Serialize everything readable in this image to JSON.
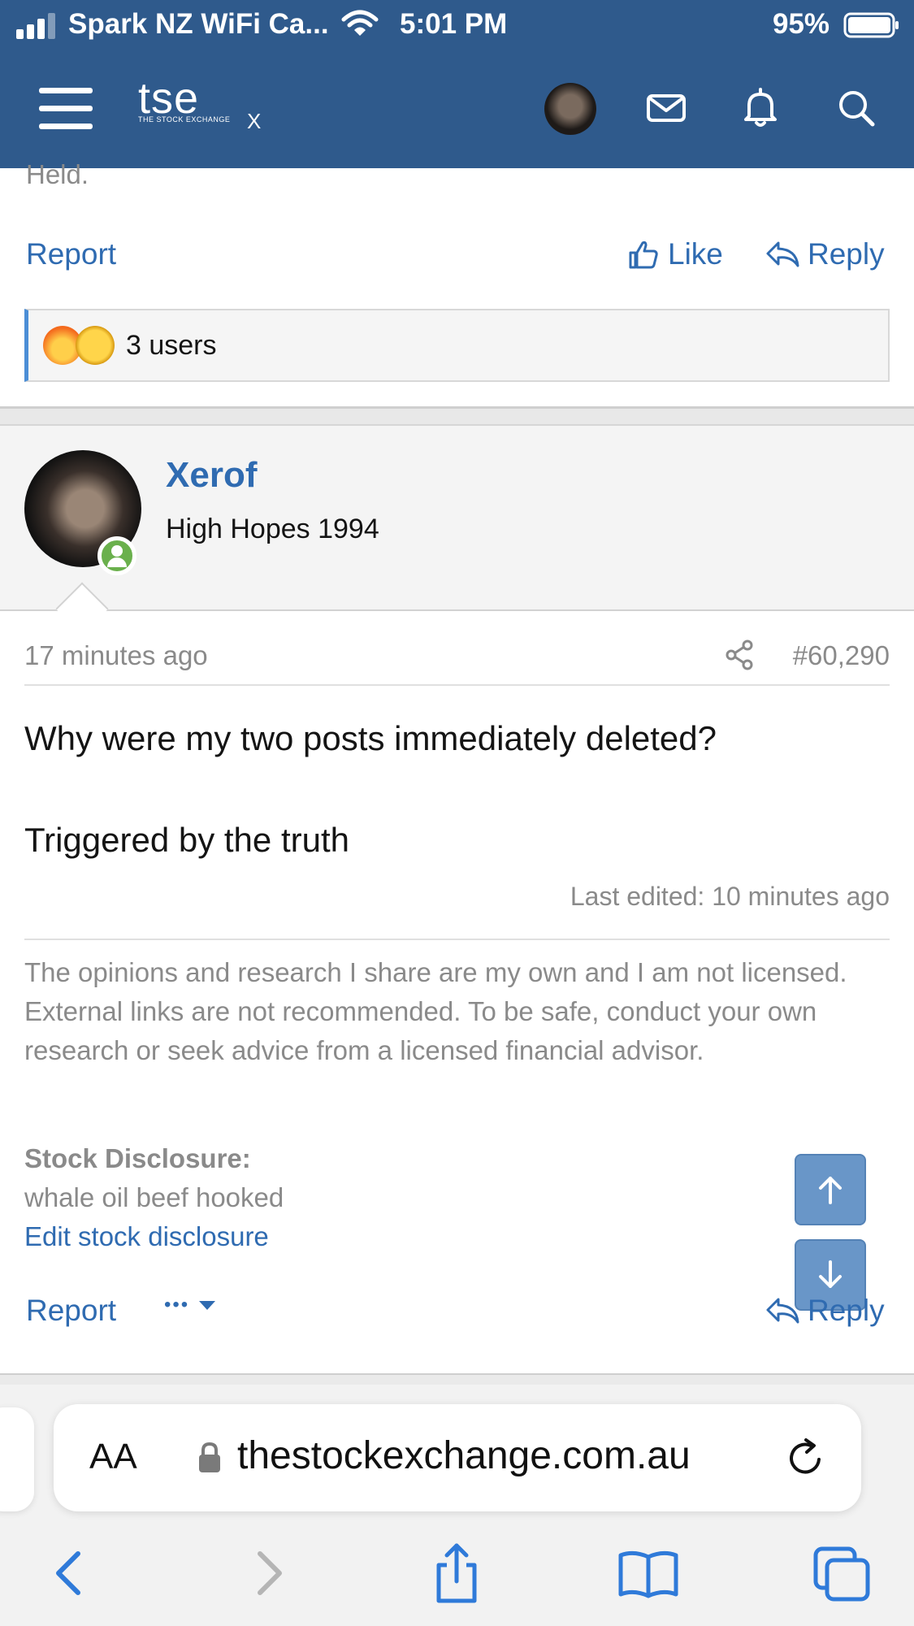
{
  "status_bar": {
    "carrier": "Spark NZ WiFi Ca...",
    "time": "5:01 PM",
    "battery": "95%"
  },
  "header": {
    "logo_text": "tse",
    "logo_subtitle": "THE STOCK EXCHANGE",
    "logo_mark": "X",
    "brand_color": "#2f5a8c",
    "icons": [
      "menu-icon",
      "avatar",
      "mail-icon",
      "bell-icon",
      "search-icon"
    ]
  },
  "previous_post": {
    "clipped_text": "Held.",
    "report": "Report",
    "like": "Like",
    "reply": "Reply",
    "reactions": {
      "emojis": [
        "fire",
        "rolling-laughing"
      ],
      "label": "3 users"
    }
  },
  "post": {
    "username": "Xerof",
    "user_title": "High Hopes 1994",
    "online": true,
    "time": "17 minutes ago",
    "post_number": "#60,290",
    "body": [
      "Why were my two posts immediately deleted?",
      "Triggered by the truth"
    ],
    "last_edited": "Last edited: 10 minutes ago",
    "signature": "The opinions and research I share are my own and I am not licensed. External links are not recommended. To be safe, conduct your own research or seek advice from a licensed financial advisor.",
    "disclosure_label": "Stock Disclosure:",
    "disclosure_value": "whale oil beef hooked",
    "edit_disclosure": "Edit stock disclosure",
    "report": "Report",
    "more": "•••",
    "reply": "Reply"
  },
  "safari": {
    "aa_label": "AA",
    "url": "thestockexchange.com.au",
    "accent_color": "#2f6bb1"
  }
}
